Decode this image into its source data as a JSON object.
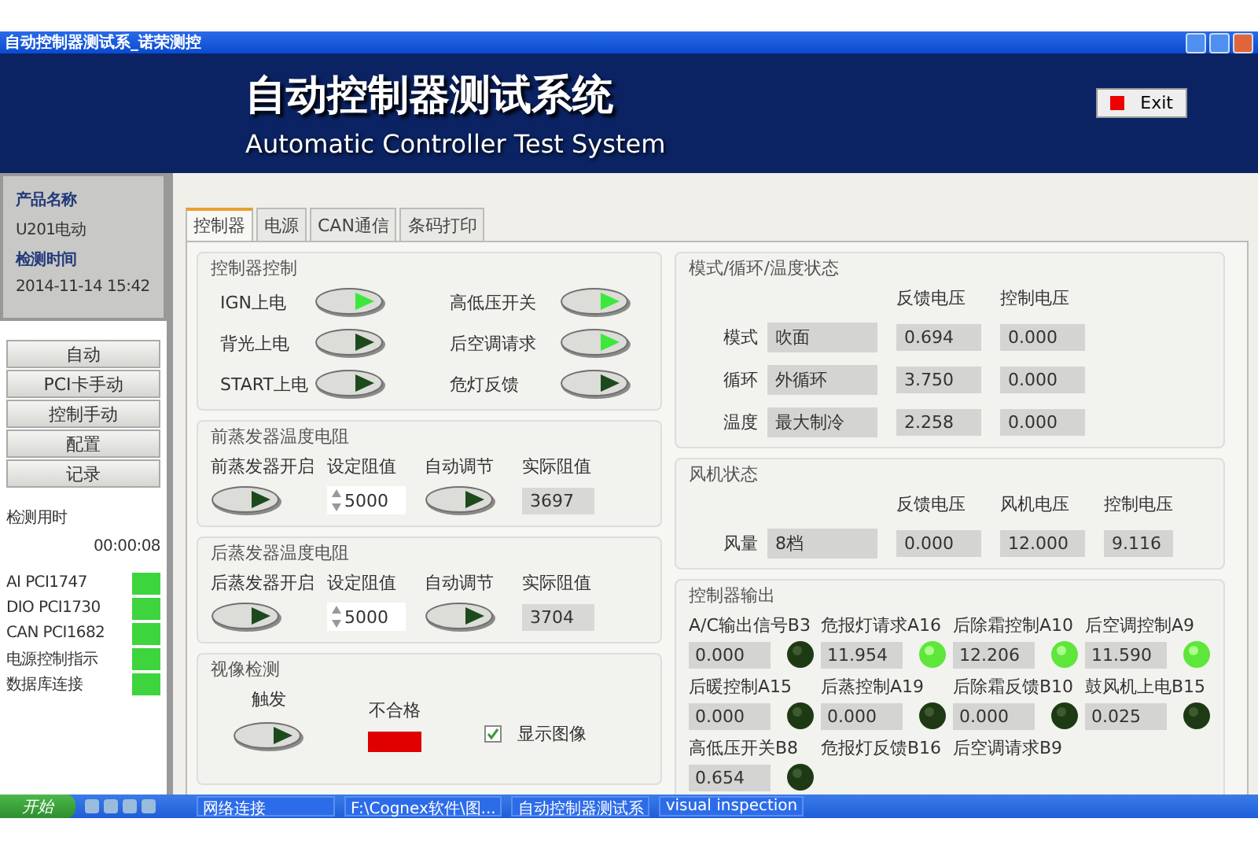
{
  "window": {
    "title": "自动控制器测试系_诺荣测控"
  },
  "header": {
    "title": "自动控制器测试系统",
    "subtitle": "Automatic Controller Test System",
    "exit_button": "Exit"
  },
  "sidebar": {
    "product_label": "产品名称",
    "product": "U201电动",
    "time_label": "检测时间",
    "time": "2014-11-14 15:42",
    "buttons": [
      "自动",
      "PCI卡手动",
      "控制手动",
      "配置",
      "记录"
    ],
    "elapsed_label": "检测用时",
    "elapsed": "00:00:08",
    "indicators": [
      {
        "label": "AI PCI1747",
        "on": true
      },
      {
        "label": "DIO PCI1730",
        "on": true
      },
      {
        "label": "CAN PCI1682",
        "on": true
      },
      {
        "label": "电源控制指示",
        "on": true
      },
      {
        "label": "数据库连接",
        "on": true
      }
    ]
  },
  "tabs": [
    {
      "label": "控制器",
      "selected": true
    },
    {
      "label": "电源",
      "selected": false
    },
    {
      "label": "CAN通信",
      "selected": false
    },
    {
      "label": "条码打印",
      "selected": false
    }
  ],
  "controller_control": {
    "title": "控制器控制",
    "switches": [
      {
        "label": "IGN上电",
        "on": true
      },
      {
        "label": "高低压开关",
        "on": true
      },
      {
        "label": "背光上电",
        "on": false
      },
      {
        "label": "后空调请求",
        "on": true
      },
      {
        "label": "START上电",
        "on": false
      },
      {
        "label": "危灯反馈",
        "on": false
      }
    ]
  },
  "evaporators": [
    {
      "title": "前蒸发器温度电阻",
      "switch_label": "前蒸发器开启",
      "switch_on": false,
      "setpoint_label": "设定阻值",
      "setpoint": "5000",
      "auto_label": "自动调节",
      "auto_on": false,
      "actual_label": "实际阻值",
      "actual": "3697"
    },
    {
      "title": "后蒸发器温度电阻",
      "switch_label": "后蒸发器开启",
      "switch_on": false,
      "setpoint_label": "设定阻值",
      "setpoint": "5000",
      "auto_label": "自动调节",
      "auto_on": false,
      "actual_label": "实际阻值",
      "actual": "3704"
    }
  ],
  "vision": {
    "title": "视像检测",
    "trigger_label": "触发",
    "trigger_on": false,
    "result_label": "不合格",
    "result_pass": false,
    "show_image_label": "显示图像",
    "show_image_checked": true
  },
  "mode_status": {
    "title": "模式/循环/温度状态",
    "columns": [
      "反馈电压",
      "控制电压"
    ],
    "rows": [
      {
        "label": "模式",
        "value": "吹面",
        "values": [
          "0.694",
          "0.000"
        ]
      },
      {
        "label": "循环",
        "value": "外循环",
        "values": [
          "3.750",
          "0.000"
        ]
      },
      {
        "label": "温度",
        "value": "最大制冷",
        "values": [
          "2.258",
          "0.000"
        ]
      }
    ]
  },
  "fan_status": {
    "title": "风机状态",
    "columns": [
      "反馈电压",
      "风机电压",
      "控制电压"
    ],
    "rows": [
      {
        "label": "风量",
        "value": "8档",
        "values": [
          "0.000",
          "12.000",
          "9.116"
        ]
      }
    ]
  },
  "outputs": {
    "title": "控制器输出",
    "items": [
      {
        "label": "A/C输出信号B3",
        "value": "0.000",
        "on": false
      },
      {
        "label": "危报灯请求A16",
        "value": "11.954",
        "on": true
      },
      {
        "label": "后除霜控制A10",
        "value": "12.206",
        "on": true
      },
      {
        "label": "后空调控制A9",
        "value": "11.590",
        "on": true
      },
      {
        "label": "后暖控制A15",
        "value": "0.000",
        "on": false
      },
      {
        "label": "后蒸控制A19",
        "value": "0.000",
        "on": false
      },
      {
        "label": "后除霜反馈B10",
        "value": "0.000",
        "on": false
      },
      {
        "label": "鼓风机上电B15",
        "value": "0.025",
        "on": false
      },
      {
        "label": "高低压开关B8",
        "value": "0.654",
        "on": false
      },
      {
        "label": "危报灯反馈B16"
      },
      {
        "label": "后空调请求B9"
      }
    ]
  },
  "taskbar": {
    "start": "开始",
    "items": [
      "网络连接",
      "F:\\Cognex软件\\图...",
      "自动控制器测试系",
      "visual inspection"
    ]
  }
}
